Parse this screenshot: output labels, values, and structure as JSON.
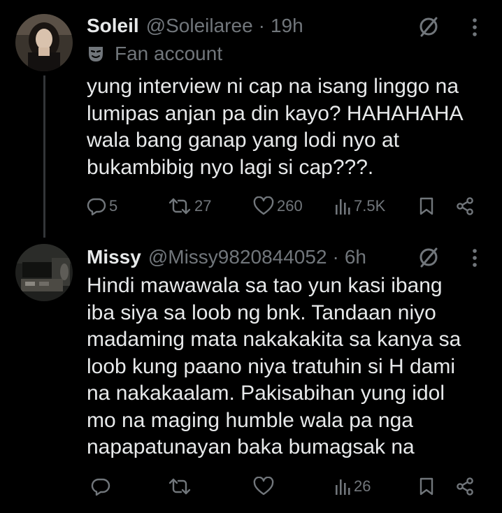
{
  "tweets": [
    {
      "name": "Soleil",
      "handle": "@Soleilaree",
      "separator": "·",
      "time": "19h",
      "label_icon": "theater-mask-icon",
      "label_text": "Fan account",
      "text_lines": [
        "yung interview ni cap na isang linggo na",
        "lumipas anjan pa din kayo? HAHAHAHA",
        "wala bang ganap yang lodi nyo at",
        "bukambibig nyo lagi si cap???."
      ],
      "actions": {
        "replies": "5",
        "reposts": "27",
        "likes": "260",
        "views": "7.5K"
      }
    },
    {
      "name": "Missy",
      "handle": "@Missy9820844052",
      "separator": "·",
      "time": "6h",
      "text_lines": [
        "Hindi mawawala sa tao yun kasi ibang",
        "iba siya sa loob ng bnk. Tandaan niyo",
        "madaming mata nakakakita sa kanya sa",
        "loob kung paano niya tratuhin si H dami",
        "na nakakaalam. Pakisabihan yung idol",
        "mo na maging humble wala pa nga",
        "napapatunayan baka bumagsak na"
      ],
      "actions": {
        "replies": "",
        "reposts": "",
        "likes": "",
        "views": "26"
      }
    }
  ],
  "colors": {
    "background": "#000000",
    "text_primary": "#e7e9ea",
    "text_secondary": "#71767b",
    "thread_line": "#333639"
  }
}
